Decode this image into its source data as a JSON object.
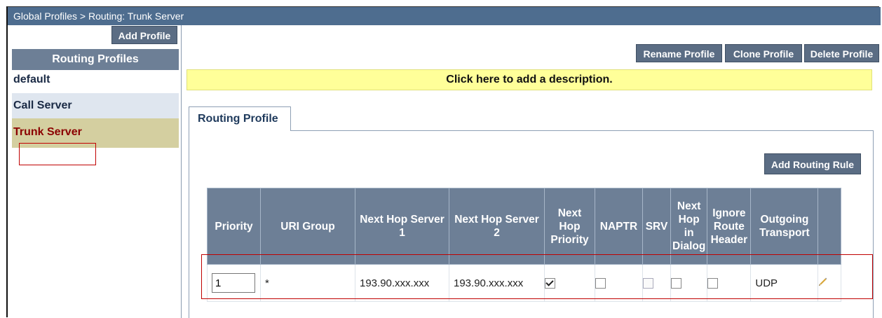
{
  "breadcrumb": "Global Profiles > Routing: Trunk Server",
  "left_pane": {
    "add_profile_label": "Add Profile",
    "routing_profiles_header": "Routing Profiles",
    "profiles": [
      {
        "label": "default"
      },
      {
        "label": "Call Server"
      },
      {
        "label": "Trunk Server"
      }
    ],
    "selected_profile": "Trunk Server"
  },
  "toolbar": {
    "rename_label": "Rename Profile",
    "clone_label": "Clone Profile",
    "delete_label": "Delete Profile"
  },
  "description_prompt": "Click here to add a description.",
  "tab_label": "Routing Profile",
  "add_routing_rule_label": "Add Routing Rule",
  "table": {
    "headers": {
      "priority": "Priority",
      "uri_group": "URI Group",
      "next_hop_1": "Next Hop Server 1",
      "next_hop_2": "Next Hop Server 2",
      "next_hop_priority": "Next Hop Priority",
      "naptr": "NAPTR",
      "srv": "SRV",
      "next_hop_in_dialog": "Next Hop in Dialog",
      "ignore_route_header": "Ignore Route Header",
      "outgoing_transport": "Outgoing Transport"
    },
    "rows": [
      {
        "priority": "1",
        "uri_group": "*",
        "next_hop_1": "193.90.xxx.xxx",
        "next_hop_2": "193.90.xxx.xxx",
        "next_hop_priority": true,
        "naptr": false,
        "srv": false,
        "next_hop_in_dialog": false,
        "ignore_route_header": false,
        "outgoing_transport": "UDP"
      }
    ]
  },
  "colors": {
    "titlebar": "#4e6d8f",
    "button": "#5b6d84",
    "header": "#6d7f96",
    "description_bg": "#ffff99",
    "selected_bg": "#d4cfa0",
    "selected_text": "#8b0000",
    "highlight_border": "#c00000"
  },
  "icons": {
    "edit": "pencil-icon"
  }
}
